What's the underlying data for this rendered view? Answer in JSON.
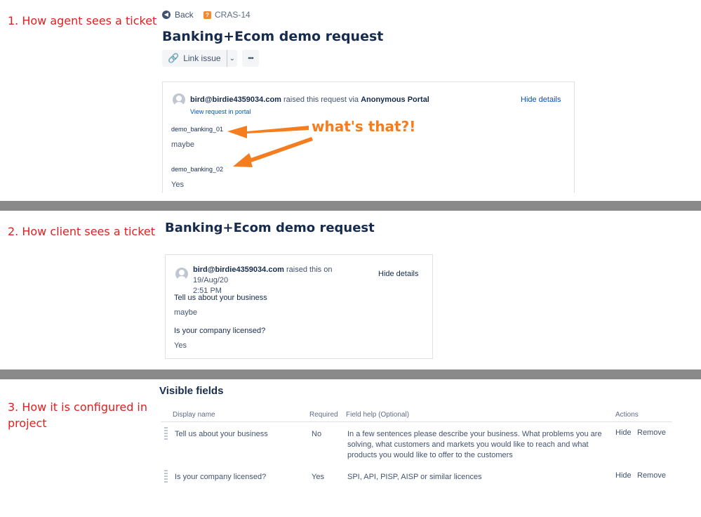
{
  "sections": {
    "s1": "1. How agent sees a ticket",
    "s2": "2. How client sees a ticket",
    "s3": "3. How it is configured in project"
  },
  "agent": {
    "back": "Back",
    "issue_key": "CRAS-14",
    "title": "Banking+Ecom demo request",
    "link_issue": "Link issue",
    "more": "•••",
    "reporter": "bird@birdie4359034.com",
    "raised_text": "raised this request via",
    "portal": "Anonymous Portal",
    "view_in_portal": "View request in portal",
    "hide_details": "Hide details",
    "fields": [
      {
        "label": "demo_banking_01",
        "value": "maybe"
      },
      {
        "label": "demo_banking_02",
        "value": "Yes"
      }
    ],
    "annotation": "what's that?!",
    "annotation_color": "#f47d20"
  },
  "client": {
    "title": "Banking+Ecom demo request",
    "reporter": "bird@birdie4359034.com",
    "raised_text": "raised this on 19/Aug/20",
    "time": "2:51 PM",
    "hide_details": "Hide details",
    "fields": [
      {
        "label": "Tell us about your business",
        "value": "maybe"
      },
      {
        "label": "Is your company licensed?",
        "value": "Yes"
      }
    ]
  },
  "config": {
    "heading": "Visible fields",
    "columns": {
      "display_name": "Display name",
      "required": "Required",
      "field_help": "Field help",
      "optional": "(Optional)",
      "actions": "Actions"
    },
    "rows": [
      {
        "name": "Tell us about your business",
        "required": "No",
        "help1": "In a few sentences please describe your business. What problems you are",
        "help2": "solving, what customers and markets you would like to reach and what",
        "help3": "products you would like to offer to the customers",
        "hide": "Hide",
        "remove": "Remove"
      },
      {
        "name": "Is your company licensed?",
        "required": "Yes",
        "help1": "SPI, API, PISP, AISP or similar licences",
        "hide": "Hide",
        "remove": "Remove"
      }
    ]
  }
}
